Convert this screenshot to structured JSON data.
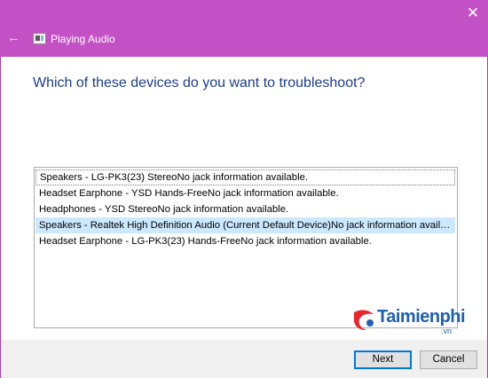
{
  "window": {
    "title": "Playing Audio",
    "close_glyph": "✕",
    "back_glyph": "←",
    "accent_color": "#c450c5"
  },
  "main": {
    "heading": "Which of these devices do you want to troubleshoot?",
    "devices": [
      "Speakers - LG-PK3(23) StereoNo jack information available.",
      "Headset Earphone - YSD Hands-FreeNo jack information available.",
      "Headphones - YSD StereoNo jack information available.",
      "Speakers - Realtek High Definition Audio (Current Default Device)No jack information available.",
      "Headset Earphone - LG-PK3(23) Hands-FreeNo jack information available."
    ],
    "focused_index": 0,
    "selected_index": 3
  },
  "watermark": {
    "brand": "Taimienphi",
    "suffix": ".vn"
  },
  "footer": {
    "next_label": "Next",
    "cancel_label": "Cancel"
  }
}
